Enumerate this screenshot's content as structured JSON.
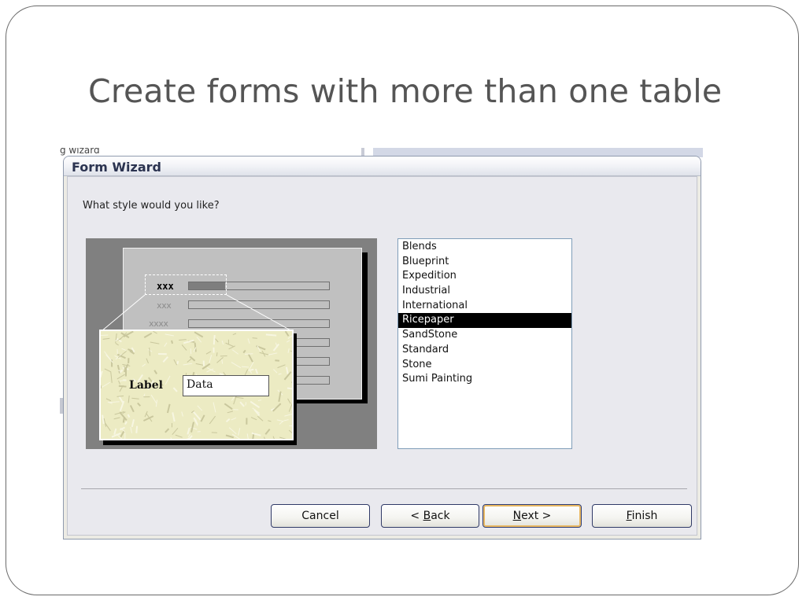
{
  "slide": {
    "title": "Create forms with more than one table"
  },
  "background": {
    "caption": "g wizard"
  },
  "dialog": {
    "title": "Form Wizard",
    "prompt": "What style would you like?",
    "preview": {
      "rows": [
        "xxx",
        "xxx",
        "xxxx"
      ],
      "zoom_label": "Label",
      "zoom_data": "Data"
    },
    "styles": [
      "Blends",
      "Blueprint",
      "Expedition",
      "Industrial",
      "International",
      "Ricepaper",
      "SandStone",
      "Standard",
      "Stone",
      "Sumi Painting"
    ],
    "selected_style": "Ricepaper",
    "buttons": {
      "cancel": {
        "label": "Cancel"
      },
      "back": {
        "prefix": "< ",
        "accel": "B",
        "rest": "ack"
      },
      "next": {
        "accel": "N",
        "rest": "ext >"
      },
      "finish": {
        "accel": "F",
        "rest": "inish"
      }
    },
    "default_button": "next",
    "colors": {
      "selection_bg": "#000000",
      "default_button_ring": "#e8b761"
    }
  }
}
